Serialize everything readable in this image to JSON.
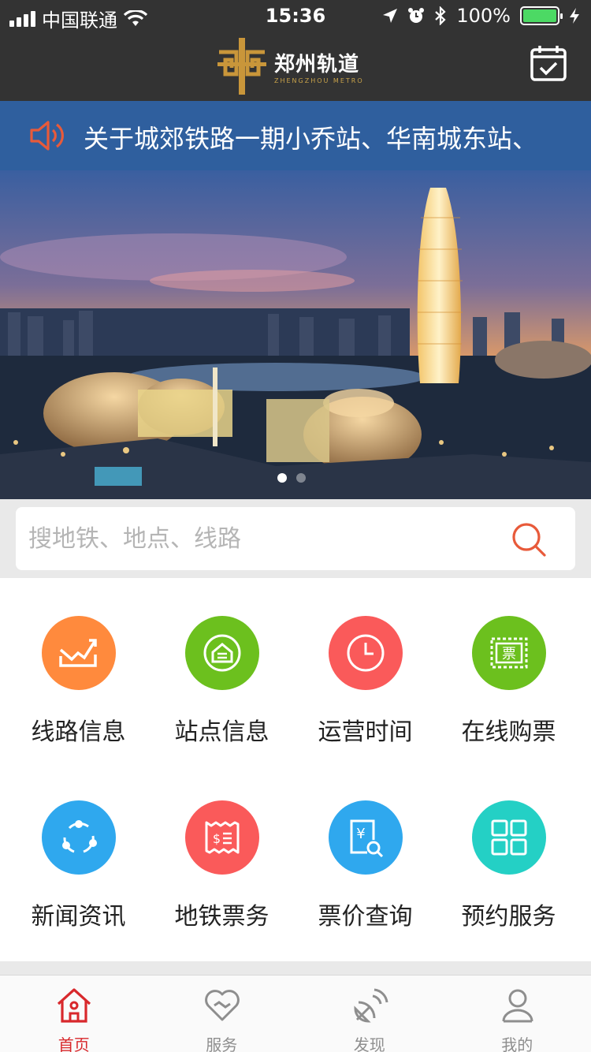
{
  "status_bar": {
    "carrier": "中国联通",
    "time": "15:36",
    "battery": "100%",
    "battery_level": 1.0
  },
  "header": {
    "logo_cn": "郑州轨道",
    "logo_en": "ZHENGZHOU METRO",
    "calendar_icon": "calendar-check-icon"
  },
  "notice": {
    "icon": "speaker-icon",
    "text": "关于城郊铁路一期小乔站、华南城东站、"
  },
  "banner": {
    "dots_total": 2,
    "active_index": 0
  },
  "search": {
    "placeholder": "搜地铁、地点、线路",
    "value": "",
    "icon": "search-icon"
  },
  "services": [
    {
      "label": "线路信息",
      "icon": "route-chart-icon",
      "color": "#ff8a3d"
    },
    {
      "label": "站点信息",
      "icon": "station-icon",
      "color": "#6cc01e"
    },
    {
      "label": "运营时间",
      "icon": "clock-icon",
      "color": "#fa5a5a"
    },
    {
      "label": "在线购票",
      "icon": "ticket-icon",
      "color": "#6cc01e"
    },
    {
      "label": "新闻资讯",
      "icon": "news-share-icon",
      "color": "#2fa8ee"
    },
    {
      "label": "地铁票务",
      "icon": "receipt-icon",
      "color": "#fa5a5a"
    },
    {
      "label": "票价查询",
      "icon": "fare-query-icon",
      "color": "#2fa8ee"
    },
    {
      "label": "预约服务",
      "icon": "grid-apps-icon",
      "color": "#24d0c5"
    }
  ],
  "tabbar": {
    "active": 0,
    "items": [
      {
        "label": "首页",
        "icon": "home-icon"
      },
      {
        "label": "服务",
        "icon": "heart-icon"
      },
      {
        "label": "发现",
        "icon": "discover-icon"
      },
      {
        "label": "我的",
        "icon": "user-icon"
      }
    ]
  },
  "colors": {
    "header_bg": "#333333",
    "notice_bg": "#2f5f9e",
    "accent": "#d8282c",
    "speaker": "#e85a3a"
  }
}
